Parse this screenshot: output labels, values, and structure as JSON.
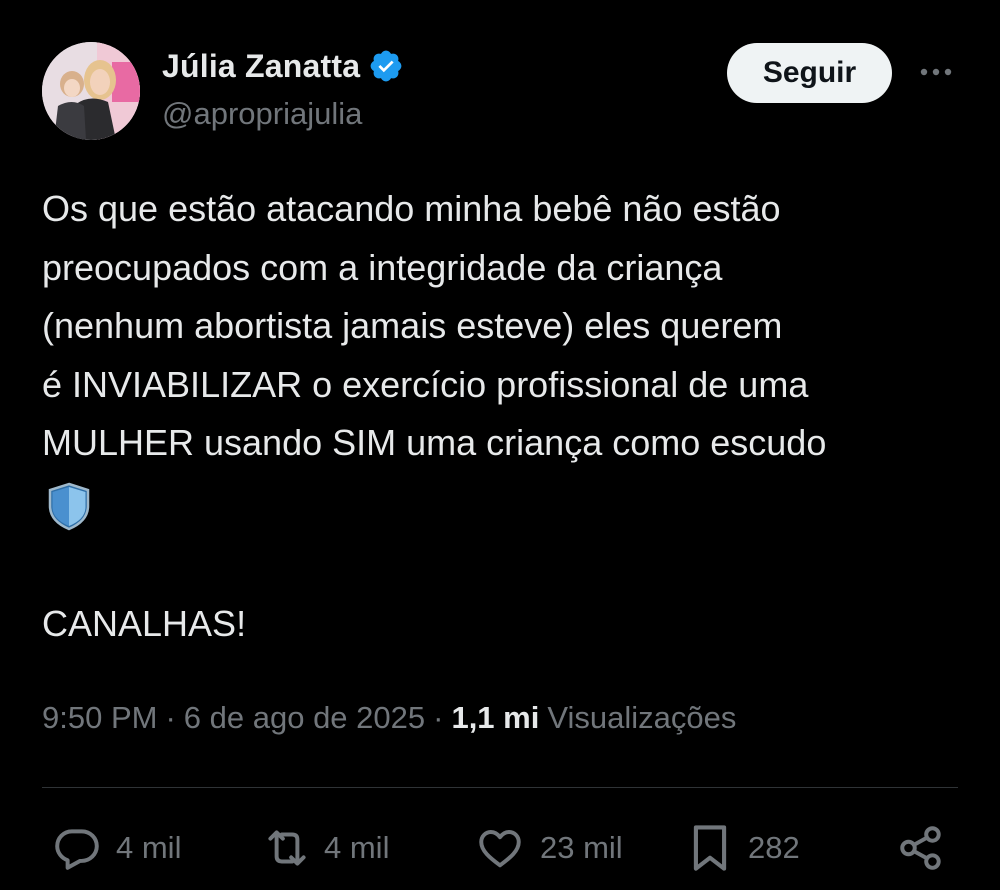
{
  "tweet": {
    "author": {
      "display_name": "Júlia Zanatta",
      "handle": "@apropriajulia",
      "verified_icon": "verified-badge-icon"
    },
    "follow_label": "Seguir",
    "more_icon": "more-options-icon",
    "text_lines": [
      "Os que estão atacando minha bebê não estão",
      "preocupados com a integridade da criança",
      "(nenhum abortista jamais esteve) eles querem",
      "é INVIABILIZAR o exercício profissional de uma",
      "MULHER usando SIM uma criança como escudo"
    ],
    "emoji": "shield-emoji",
    "shout": "CANALHAS!",
    "time": "9:50 PM",
    "date": "6 de ago de 2025",
    "views_count": "1,1 mi",
    "views_label": "Visualizações"
  },
  "actions": {
    "replies": "4 mil",
    "reposts": "4 mil",
    "likes": "23 mil",
    "bookmarks": "282"
  },
  "colors": {
    "background": "#000000",
    "text": "#e7e9ea",
    "muted": "#71767b",
    "verified": "#1d9bf0",
    "divider": "#2f3336",
    "button_bg": "#eff3f4"
  }
}
